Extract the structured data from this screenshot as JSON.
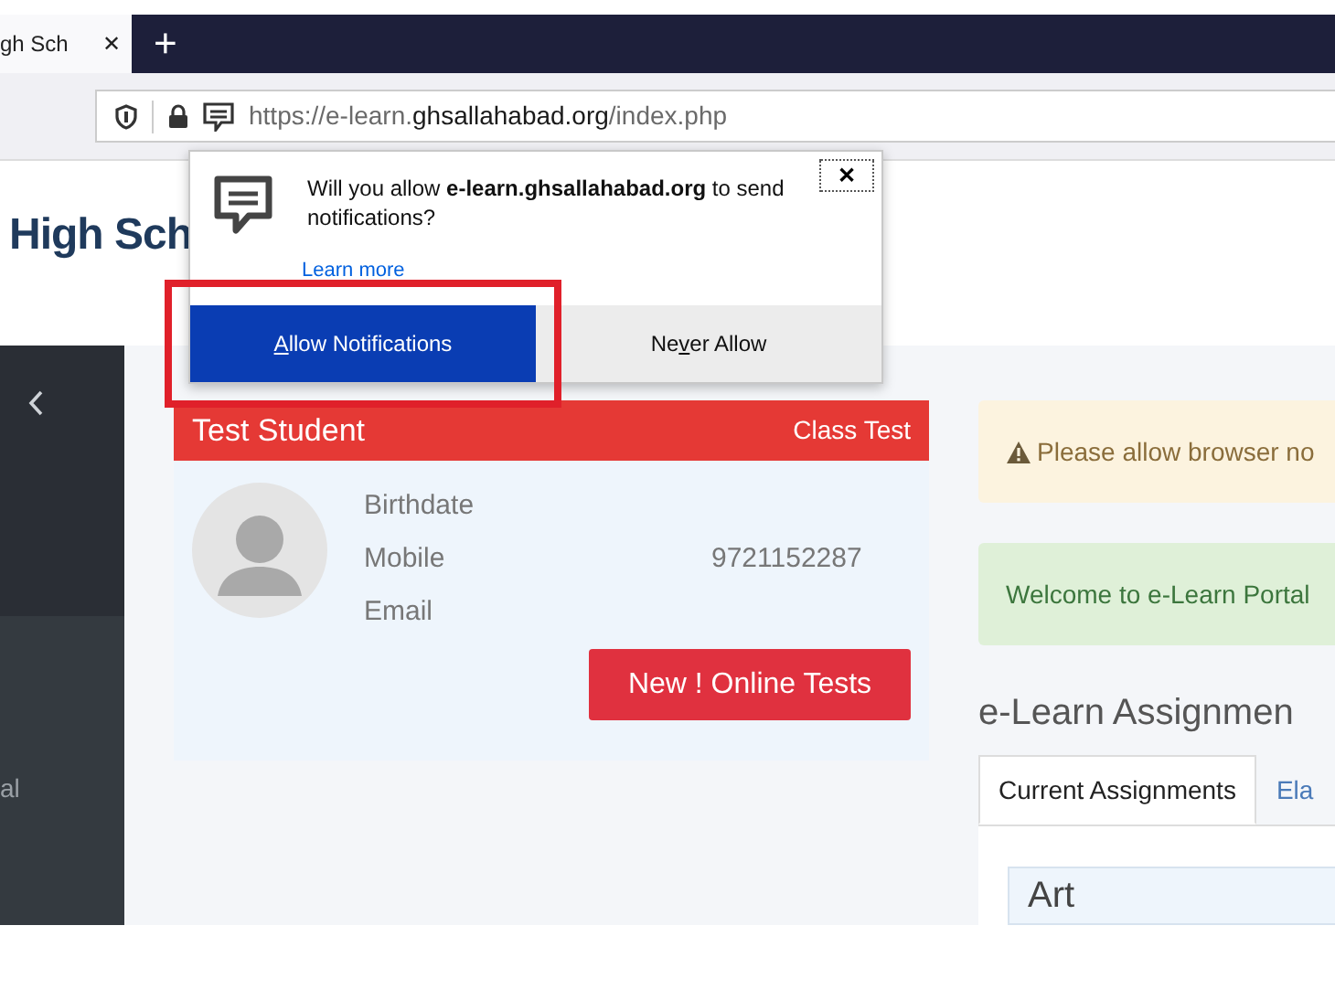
{
  "browser": {
    "tab": {
      "title": "gh Sch",
      "close": "✕"
    },
    "new_tab": "+",
    "url": "https://e-learn.**ghsallahabad.org**/index.php"
  },
  "notification_popup": {
    "message": "Will you allow **e-learn.ghsallahabad.org** to send notifications?",
    "link": "Learn more",
    "close": "✕",
    "buttons": [
      {
        "access_key": "A",
        "label_rest": "llow Notifications",
        "kind": "primary",
        "highlighted": true
      },
      {
        "label_start": "Ne",
        "access_key": "v",
        "label_rest": "er Allow",
        "kind": "secondary",
        "highlighted": false
      }
    ]
  },
  "site": {
    "logo": "High Sch"
  },
  "sidebar": {
    "item_text": "al"
  },
  "profile_card": {
    "name": "Test Student",
    "tag": "Class Test",
    "fields": [
      {
        "label": "Birthdate"
      },
      {
        "label": "Mobile",
        "value": "9721152287"
      },
      {
        "label": "Email"
      }
    ],
    "button": "New ! Online Tests"
  },
  "alerts": [
    {
      "kind": "warning",
      "text": "Please allow browser no"
    },
    {
      "kind": "success",
      "text": "Welcome to e-Learn Portal"
    }
  ],
  "assignments": {
    "heading": "e-Learn Assignmen",
    "tabs": [
      {
        "label": "Current Assignments",
        "selected": true
      },
      {
        "label": "Ela",
        "selected": false
      }
    ],
    "card_title": "Art"
  }
}
